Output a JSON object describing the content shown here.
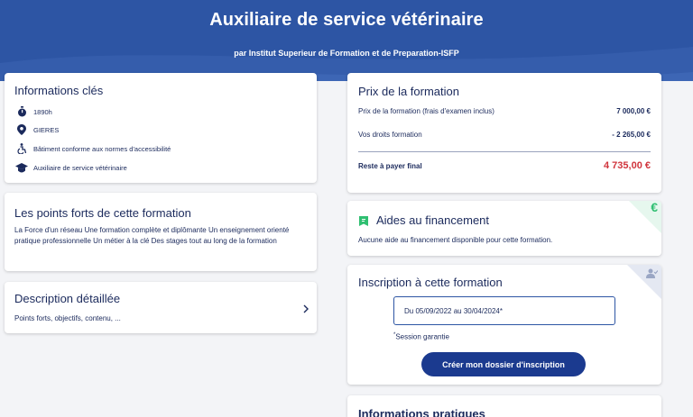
{
  "header": {
    "title": "Auxiliaire de service vétérinaire",
    "subtitle": "par Institut Superieur de Formation et de Preparation-ISFP"
  },
  "key_info": {
    "title": "Informations clés",
    "items": [
      {
        "icon": "stopwatch-icon",
        "text": "1890h"
      },
      {
        "icon": "location-pin-icon",
        "text": "GIERES"
      },
      {
        "icon": "accessibility-icon",
        "text": "Bâtiment conforme aux normes d'accessibilité"
      },
      {
        "icon": "graduation-cap-icon",
        "text": "Auxiliaire de service vétérinaire"
      }
    ]
  },
  "strengths": {
    "title": "Les points forts de cette formation",
    "text": "La Force d'un réseau Une formation complète et diplômante Un enseignement orienté pratique professionnelle Un métier à la clé Des stages tout au long de la formation"
  },
  "description": {
    "title": "Description détaillée",
    "text": "Points forts, objectifs, contenu, ..."
  },
  "price": {
    "title": "Prix de la formation",
    "rows": [
      {
        "label": "Prix de la formation (frais d'examen inclus)",
        "value": "7 000,00 €"
      },
      {
        "label": "Vos droits formation",
        "value": "- 2 265,00 €"
      }
    ],
    "total_label": "Reste à payer final",
    "total_value": "4 735,00 €"
  },
  "funding": {
    "title": "Aides au financement",
    "text": "Aucune aide au financement disponible pour cette formation.",
    "corner_symbol": "€"
  },
  "registration": {
    "title": "Inscription à cette formation",
    "session_value": "Du 05/09/2022 au 30/04/2024*",
    "note_star": "*",
    "note_text": "Session garantie",
    "button_label": "Créer mon dossier d'inscription"
  },
  "practical": {
    "title": "Informations pratiques"
  },
  "colors": {
    "header_bg": "#2d55a4",
    "text": "#1b2a5c",
    "total_red": "#d0343c",
    "button_bg": "#1b3a8f",
    "funding_green": "#2fbf71"
  }
}
